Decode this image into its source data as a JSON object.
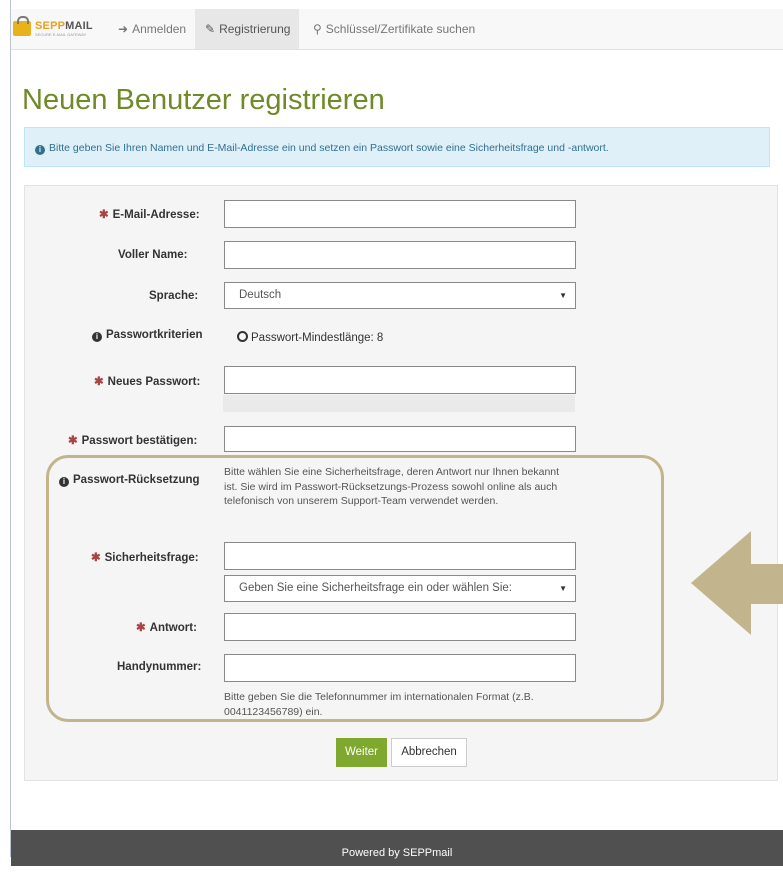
{
  "navbar": {
    "brand_part1": "SEPP",
    "brand_part2": "MAIL",
    "brand_tagline": "SECURE E-MAIL GATEWAY",
    "items": [
      {
        "label": "Anmelden",
        "icon": "sign-in-icon"
      },
      {
        "label": "Registrierung",
        "icon": "edit-icon"
      },
      {
        "label": "Schlüssel/Zertifikate suchen",
        "icon": "search-icon"
      }
    ]
  },
  "page_title": "Neuen Benutzer registrieren",
  "info_alert": "Bitte geben Sie Ihren Namen und E-Mail-Adresse ein und setzen ein Passwort sowie eine Sicherheitsfrage und -antwort.",
  "form": {
    "email_label": "E-Mail-Adresse:",
    "name_label": "Voller Name:",
    "language_label": "Sprache:",
    "language_value": "Deutsch",
    "criteria_label": "Passwortkriterien",
    "criteria_item": "Passwort-Mindestlänge: 8",
    "new_password_label": "Neues Passwort:",
    "confirm_password_label": "Passwort bestätigen:",
    "reset_label": "Passwort-Rücksetzung",
    "reset_help": "Bitte wählen Sie eine Sicherheitsfrage, deren Antwort nur Ihnen bekannt ist. Sie wird im Passwort-Rücksetzungs-Prozess sowohl online als auch telefonisch von unserem Support-Team verwendet werden.",
    "security_question_label": "Sicherheitsfrage:",
    "security_question_select": "Geben Sie eine Sicherheitsfrage ein oder wählen Sie:",
    "answer_label": "Antwort:",
    "mobile_label": "Handynummer:",
    "mobile_help": "Bitte geben Sie die Telefonnummer im internationalen Format (z.B. 0041123456789) ein."
  },
  "buttons": {
    "submit": "Weiter",
    "cancel": "Abbrechen"
  },
  "footer": "Powered by SEPPmail",
  "colors": {
    "title_green": "#6f8a28",
    "highlight": "#c2b48c",
    "primary_button": "#7ea82e"
  }
}
